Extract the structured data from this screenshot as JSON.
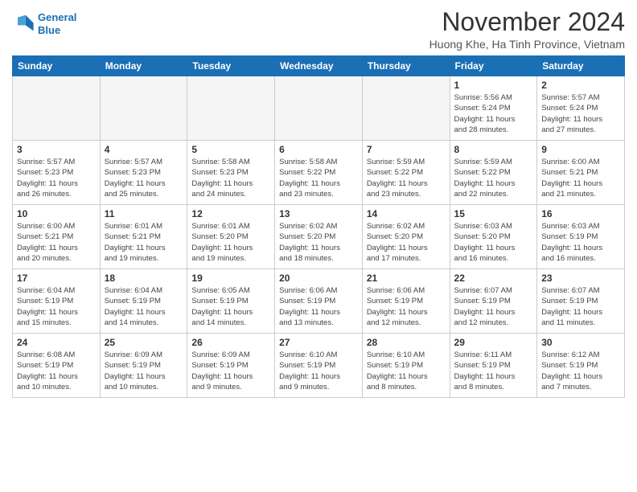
{
  "header": {
    "logo_line1": "General",
    "logo_line2": "Blue",
    "month_title": "November 2024",
    "location": "Huong Khe, Ha Tinh Province, Vietnam"
  },
  "weekdays": [
    "Sunday",
    "Monday",
    "Tuesday",
    "Wednesday",
    "Thursday",
    "Friday",
    "Saturday"
  ],
  "weeks": [
    [
      {
        "day": "",
        "info": ""
      },
      {
        "day": "",
        "info": ""
      },
      {
        "day": "",
        "info": ""
      },
      {
        "day": "",
        "info": ""
      },
      {
        "day": "",
        "info": ""
      },
      {
        "day": "1",
        "info": "Sunrise: 5:56 AM\nSunset: 5:24 PM\nDaylight: 11 hours\nand 28 minutes."
      },
      {
        "day": "2",
        "info": "Sunrise: 5:57 AM\nSunset: 5:24 PM\nDaylight: 11 hours\nand 27 minutes."
      }
    ],
    [
      {
        "day": "3",
        "info": "Sunrise: 5:57 AM\nSunset: 5:23 PM\nDaylight: 11 hours\nand 26 minutes."
      },
      {
        "day": "4",
        "info": "Sunrise: 5:57 AM\nSunset: 5:23 PM\nDaylight: 11 hours\nand 25 minutes."
      },
      {
        "day": "5",
        "info": "Sunrise: 5:58 AM\nSunset: 5:23 PM\nDaylight: 11 hours\nand 24 minutes."
      },
      {
        "day": "6",
        "info": "Sunrise: 5:58 AM\nSunset: 5:22 PM\nDaylight: 11 hours\nand 23 minutes."
      },
      {
        "day": "7",
        "info": "Sunrise: 5:59 AM\nSunset: 5:22 PM\nDaylight: 11 hours\nand 23 minutes."
      },
      {
        "day": "8",
        "info": "Sunrise: 5:59 AM\nSunset: 5:22 PM\nDaylight: 11 hours\nand 22 minutes."
      },
      {
        "day": "9",
        "info": "Sunrise: 6:00 AM\nSunset: 5:21 PM\nDaylight: 11 hours\nand 21 minutes."
      }
    ],
    [
      {
        "day": "10",
        "info": "Sunrise: 6:00 AM\nSunset: 5:21 PM\nDaylight: 11 hours\nand 20 minutes."
      },
      {
        "day": "11",
        "info": "Sunrise: 6:01 AM\nSunset: 5:21 PM\nDaylight: 11 hours\nand 19 minutes."
      },
      {
        "day": "12",
        "info": "Sunrise: 6:01 AM\nSunset: 5:20 PM\nDaylight: 11 hours\nand 19 minutes."
      },
      {
        "day": "13",
        "info": "Sunrise: 6:02 AM\nSunset: 5:20 PM\nDaylight: 11 hours\nand 18 minutes."
      },
      {
        "day": "14",
        "info": "Sunrise: 6:02 AM\nSunset: 5:20 PM\nDaylight: 11 hours\nand 17 minutes."
      },
      {
        "day": "15",
        "info": "Sunrise: 6:03 AM\nSunset: 5:20 PM\nDaylight: 11 hours\nand 16 minutes."
      },
      {
        "day": "16",
        "info": "Sunrise: 6:03 AM\nSunset: 5:19 PM\nDaylight: 11 hours\nand 16 minutes."
      }
    ],
    [
      {
        "day": "17",
        "info": "Sunrise: 6:04 AM\nSunset: 5:19 PM\nDaylight: 11 hours\nand 15 minutes."
      },
      {
        "day": "18",
        "info": "Sunrise: 6:04 AM\nSunset: 5:19 PM\nDaylight: 11 hours\nand 14 minutes."
      },
      {
        "day": "19",
        "info": "Sunrise: 6:05 AM\nSunset: 5:19 PM\nDaylight: 11 hours\nand 14 minutes."
      },
      {
        "day": "20",
        "info": "Sunrise: 6:06 AM\nSunset: 5:19 PM\nDaylight: 11 hours\nand 13 minutes."
      },
      {
        "day": "21",
        "info": "Sunrise: 6:06 AM\nSunset: 5:19 PM\nDaylight: 11 hours\nand 12 minutes."
      },
      {
        "day": "22",
        "info": "Sunrise: 6:07 AM\nSunset: 5:19 PM\nDaylight: 11 hours\nand 12 minutes."
      },
      {
        "day": "23",
        "info": "Sunrise: 6:07 AM\nSunset: 5:19 PM\nDaylight: 11 hours\nand 11 minutes."
      }
    ],
    [
      {
        "day": "24",
        "info": "Sunrise: 6:08 AM\nSunset: 5:19 PM\nDaylight: 11 hours\nand 10 minutes."
      },
      {
        "day": "25",
        "info": "Sunrise: 6:09 AM\nSunset: 5:19 PM\nDaylight: 11 hours\nand 10 minutes."
      },
      {
        "day": "26",
        "info": "Sunrise: 6:09 AM\nSunset: 5:19 PM\nDaylight: 11 hours\nand 9 minutes."
      },
      {
        "day": "27",
        "info": "Sunrise: 6:10 AM\nSunset: 5:19 PM\nDaylight: 11 hours\nand 9 minutes."
      },
      {
        "day": "28",
        "info": "Sunrise: 6:10 AM\nSunset: 5:19 PM\nDaylight: 11 hours\nand 8 minutes."
      },
      {
        "day": "29",
        "info": "Sunrise: 6:11 AM\nSunset: 5:19 PM\nDaylight: 11 hours\nand 8 minutes."
      },
      {
        "day": "30",
        "info": "Sunrise: 6:12 AM\nSunset: 5:19 PM\nDaylight: 11 hours\nand 7 minutes."
      }
    ]
  ]
}
